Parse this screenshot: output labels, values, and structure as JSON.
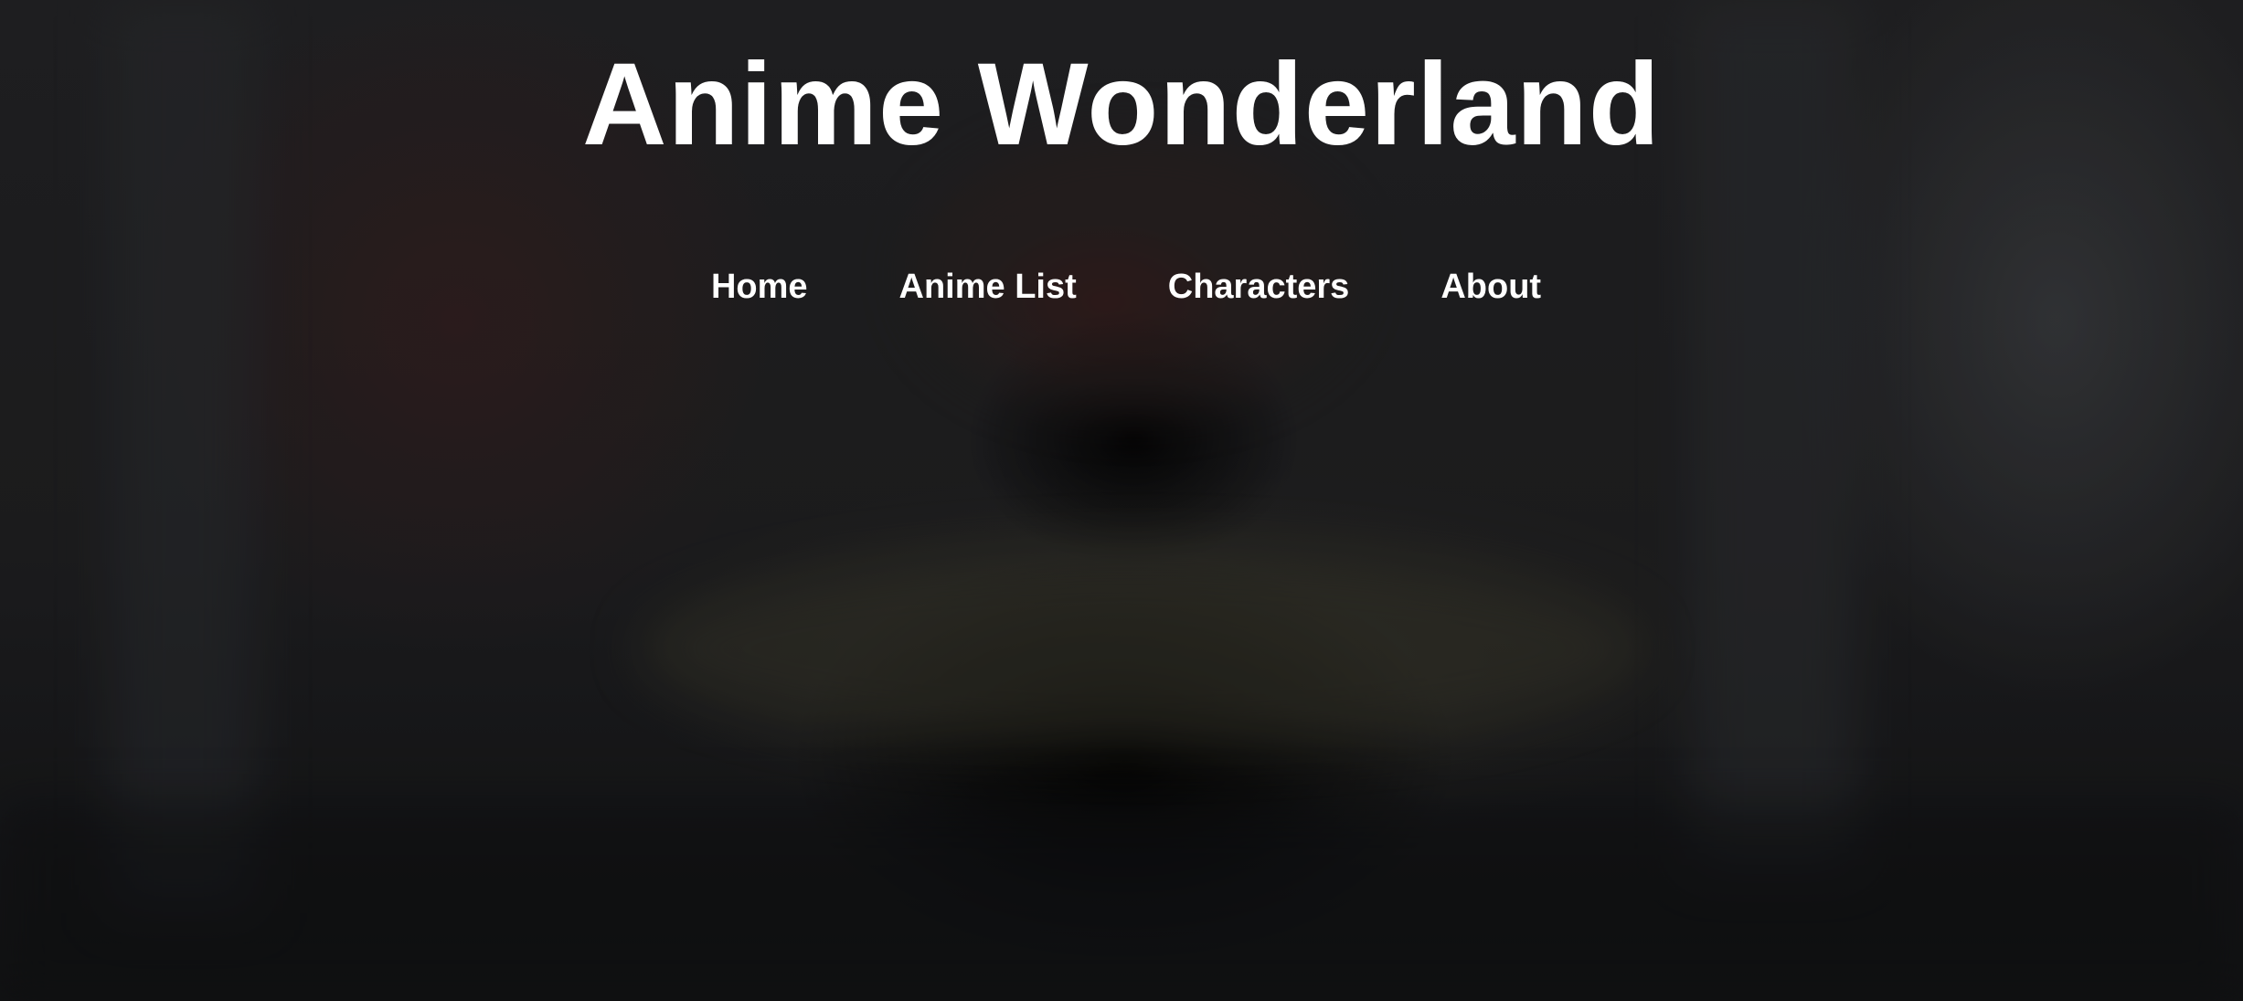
{
  "site": {
    "title": "Anime Wonderland"
  },
  "nav": {
    "items": [
      {
        "label": "Home"
      },
      {
        "label": "Anime List"
      },
      {
        "label": "Characters"
      },
      {
        "label": "About"
      }
    ]
  },
  "colors": {
    "text": "#ffffff",
    "background": "#1c1d1f"
  }
}
